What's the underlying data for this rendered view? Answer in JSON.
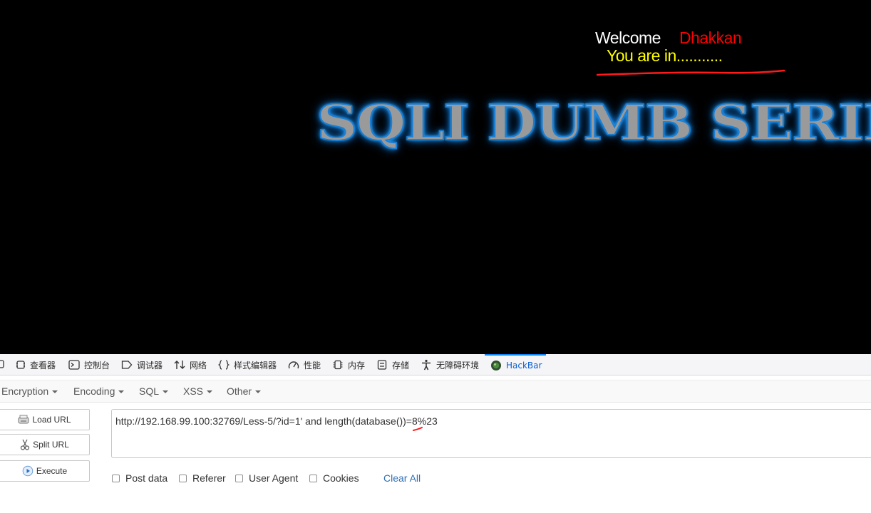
{
  "page": {
    "welcome": "Welcome",
    "user": "Dhakkan",
    "status": "You are in...........",
    "banner": "SQLI DUMB SERIES"
  },
  "devtools": {
    "tabs": [
      {
        "label": "查看器",
        "icon": "inspector-icon"
      },
      {
        "label": "控制台",
        "icon": "console-icon"
      },
      {
        "label": "调试器",
        "icon": "debugger-icon"
      },
      {
        "label": "网络",
        "icon": "network-icon"
      },
      {
        "label": "样式编辑器",
        "icon": "style-editor-icon"
      },
      {
        "label": "性能",
        "icon": "performance-icon"
      },
      {
        "label": "内存",
        "icon": "memory-icon"
      },
      {
        "label": "存储",
        "icon": "storage-icon"
      },
      {
        "label": "无障碍环境",
        "icon": "accessibility-icon"
      },
      {
        "label": "HackBar",
        "icon": "hackbar-icon",
        "active": true
      }
    ]
  },
  "hackbar": {
    "menu": [
      "Encryption",
      "Encoding",
      "SQL",
      "XSS",
      "Other"
    ],
    "buttons": {
      "load": "Load URL",
      "split": "Split URL",
      "execute": "Execute"
    },
    "url": "http://192.168.99.100:32769/Less-5/?id=1' and length(database())=8%23",
    "options": {
      "post": "Post data",
      "referer": "Referer",
      "user_agent": "User Agent",
      "cookies": "Cookies"
    },
    "clear": "Clear All"
  },
  "colors": {
    "accent": "#0a84ff",
    "welcome": "#ffffff",
    "user": "#ff0000",
    "status": "#ffff00",
    "link": "#2f6fb3"
  }
}
